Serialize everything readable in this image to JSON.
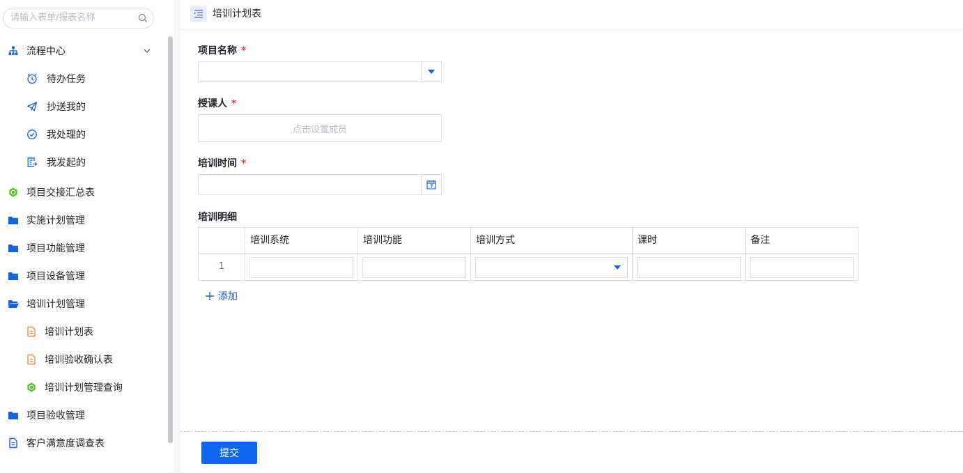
{
  "search": {
    "placeholder": "请输入表单/报表名称"
  },
  "sidebar": {
    "items": [
      {
        "label": "流程中心",
        "icon": "org-chart-icon"
      },
      {
        "label": "待办任务",
        "icon": "clock-icon"
      },
      {
        "label": "抄送我的",
        "icon": "paper-plane-icon"
      },
      {
        "label": "我处理的",
        "icon": "check-circle-icon"
      },
      {
        "label": "我发起的",
        "icon": "doc-export-icon"
      },
      {
        "label": "项目交接汇总表",
        "icon": "report-icon"
      },
      {
        "label": "实施计划管理",
        "icon": "folder-icon"
      },
      {
        "label": "项目功能管理",
        "icon": "folder-icon"
      },
      {
        "label": "项目设备管理",
        "icon": "folder-icon"
      },
      {
        "label": "培训计划管理",
        "icon": "folder-open-icon"
      },
      {
        "label": "培训计划表",
        "icon": "form-icon"
      },
      {
        "label": "培训验收确认表",
        "icon": "form-icon"
      },
      {
        "label": "培训计划管理查询",
        "icon": "report-icon"
      },
      {
        "label": "项目验收管理",
        "icon": "folder-icon"
      },
      {
        "label": "客户满意度调查表",
        "icon": "document-icon"
      }
    ]
  },
  "header": {
    "title": "培训计划表"
  },
  "form": {
    "project_name": {
      "label": "项目名称",
      "required": "*"
    },
    "trainer": {
      "label": "授课人",
      "required": "*",
      "placeholder": "点击设置成员"
    },
    "training_time": {
      "label": "培训时间",
      "required": "*"
    },
    "detail": {
      "label": "培训明细",
      "columns": [
        "培训系统",
        "培训功能",
        "培训方式",
        "课时",
        "备注"
      ],
      "rows": [
        {
          "index": "1"
        }
      ],
      "add_label": "添加"
    }
  },
  "footer": {
    "submit_label": "提交"
  },
  "colors": {
    "accent": "#0f66f5",
    "folder": "#1463e0",
    "form": "#f08a3c",
    "report": "#52c41a",
    "required": "#e64340"
  }
}
